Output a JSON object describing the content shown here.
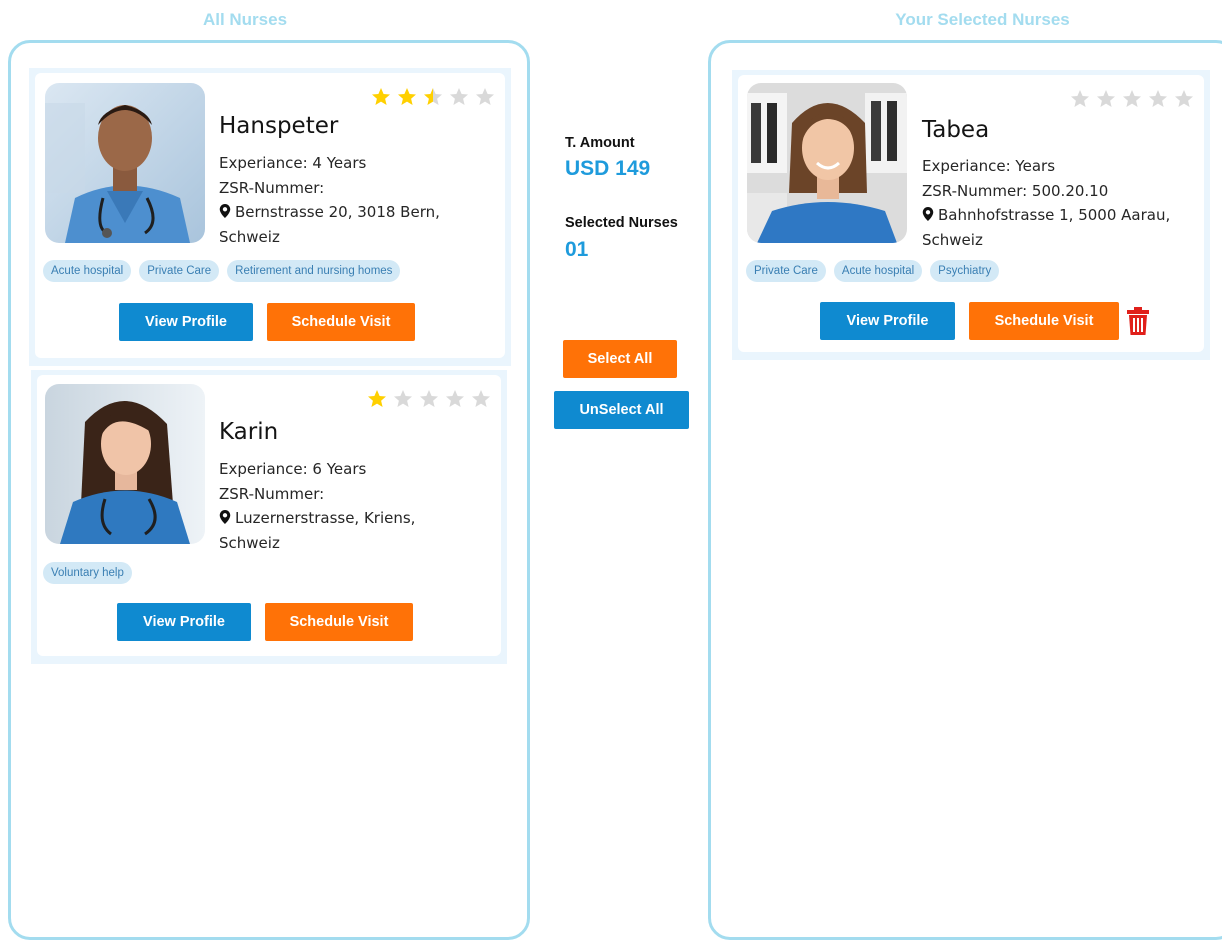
{
  "all_nurses": {
    "title": "All Nurses",
    "nurses": [
      {
        "name": "Hanspeter",
        "rating": 2.5,
        "experience": "Experiance: 4 Years",
        "zsr": "ZSR-Nummer:",
        "address_line1": "Bernstrasse 20, 3018 Bern,",
        "address_line2": "Schweiz",
        "tags": [
          "Acute hospital",
          "Private Care",
          "Retirement and nursing homes"
        ],
        "view_profile_label": "View Profile",
        "schedule_visit_label": "Schedule Visit"
      },
      {
        "name": "Karin",
        "rating": 1,
        "experience": "Experiance: 6 Years",
        "zsr": "ZSR-Nummer:",
        "address_line1": "Luzernerstrasse, Kriens,",
        "address_line2": "Schweiz",
        "tags": [
          "Voluntary help"
        ],
        "view_profile_label": "View Profile",
        "schedule_visit_label": "Schedule Visit"
      }
    ]
  },
  "summary": {
    "amount_label": "T. Amount",
    "amount_value": "USD 149",
    "selected_label": "Selected Nurses",
    "selected_value": "01",
    "select_all_label": "Select All",
    "unselect_all_label": "UnSelect All"
  },
  "selected_nurses": {
    "title": "Your Selected Nurses",
    "nurses": [
      {
        "name": "Tabea",
        "rating": 0,
        "experience": "Experiance: Years",
        "zsr": "ZSR-Nummer: 500.20.10",
        "address_line1": "Bahnhofstrasse 1, 5000 Aarau,",
        "address_line2": "Schweiz",
        "tags": [
          "Private Care",
          "Acute hospital",
          "Psychiatry"
        ],
        "view_profile_label": "View Profile",
        "schedule_visit_label": "Schedule Visit"
      }
    ]
  },
  "colors": {
    "accent_blue": "#0f8ad0",
    "accent_orange": "#ff7207",
    "star_filled": "#ffd000",
    "star_empty": "#d9d9d9",
    "delete_red": "#e0201b"
  }
}
